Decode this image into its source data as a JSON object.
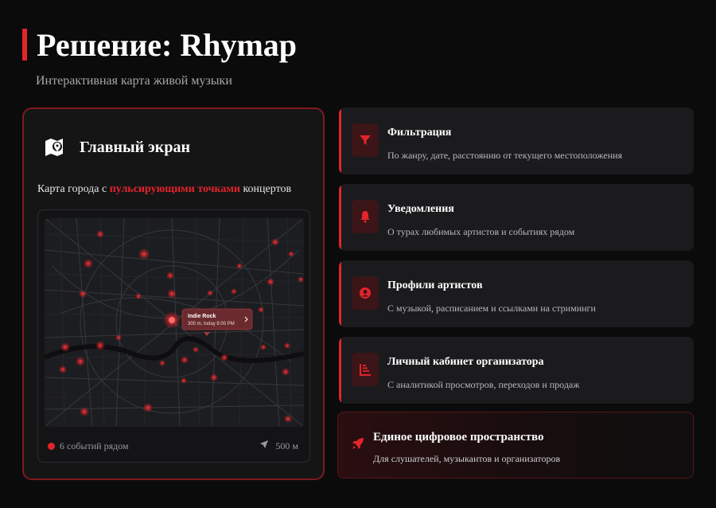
{
  "header": {
    "title": "Решение: Rhymap",
    "subtitle": "Интерактивная карта живой музыки",
    "accent_color": "#e3242b"
  },
  "main_card": {
    "icon": "map-pin-icon",
    "title": "Главный экран",
    "desc_before": "Карта города с ",
    "desc_highlight": "пульсирующими точками",
    "desc_after": " концертов",
    "map": {
      "popup_title": "Indie Rock",
      "popup_subtitle": "300 m, today 8:00 PM"
    },
    "footer_left": "6 событий рядом",
    "footer_right": "500 м"
  },
  "features": [
    {
      "icon": "filter-icon",
      "title": "Фильтрация",
      "desc": "По жанру, дате, расстоянию от текущего местоположения"
    },
    {
      "icon": "bell-icon",
      "title": "Уведомления",
      "desc": "О турах любимых артистов и событиях рядом"
    },
    {
      "icon": "user-icon",
      "title": "Профили артистов",
      "desc": "С музыкой, расписанием и ссылками на стриминги"
    },
    {
      "icon": "chart-icon",
      "title": "Личный кабинет организатора",
      "desc": "С аналитикой просмотров, переходов и продаж"
    }
  ],
  "bottom_card": {
    "icon": "rocket-icon",
    "title": "Единое цифровое пространство",
    "desc": "Для слушателей, музыкантов и организаторов"
  }
}
